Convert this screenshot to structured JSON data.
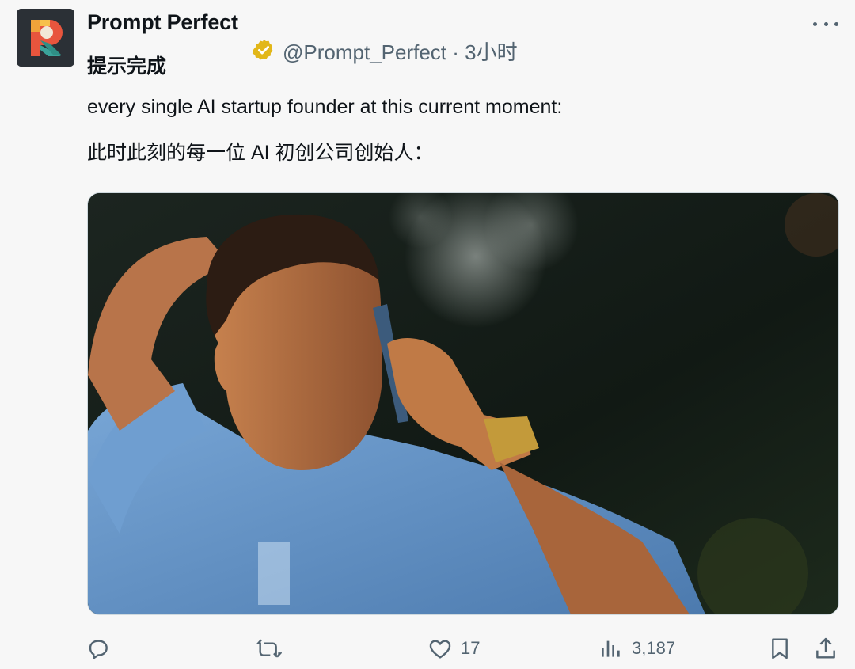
{
  "author": {
    "name": "Prompt Perfect",
    "subtitle": "提示完成",
    "handle": "@Prompt_Perfect",
    "separator": "·",
    "time": "3小时",
    "verified": true,
    "avatar_icon": "prompt-perfect-logo"
  },
  "tweet": {
    "line1": "every single AI startup founder at this current moment:",
    "line2": "此时此刻的每一位 AI 初创公司创始人："
  },
  "media": {
    "type": "video-still",
    "icon": "man-on-phone-photo"
  },
  "actions": {
    "reply": {
      "icon": "reply-icon",
      "count": ""
    },
    "retweet": {
      "icon": "retweet-icon",
      "count": ""
    },
    "like": {
      "icon": "heart-icon",
      "count": "17"
    },
    "views": {
      "icon": "analytics-icon",
      "count": "3,187"
    },
    "bookmark": {
      "icon": "bookmark-icon"
    },
    "share": {
      "icon": "share-icon"
    }
  },
  "colors": {
    "background": "#f7f7f7",
    "text": "#0f1419",
    "secondary": "#536471",
    "verified_gold": "#e2b719",
    "shirt_blue": "#5f8fc2"
  }
}
